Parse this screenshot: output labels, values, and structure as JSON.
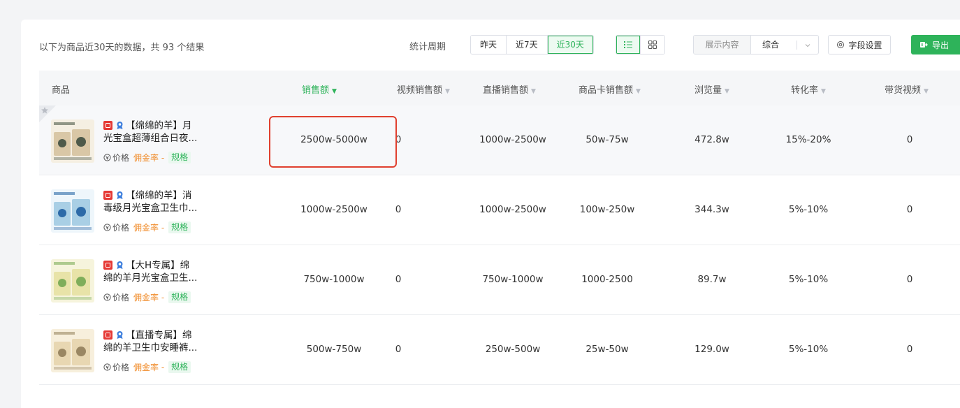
{
  "toolbar": {
    "summary": "以下为商品近30天的数据，共 93 个结果",
    "period_label": "统计周期",
    "periods": [
      "昨天",
      "近7天",
      "近30天"
    ],
    "active_period": "近30天",
    "display_label": "展示内容",
    "display_value": "综合",
    "field_settings": "字段设置",
    "export": "导出"
  },
  "table": {
    "columns": [
      "商品",
      "销售额",
      "视频销售额",
      "直播销售额",
      "商品卡销售额",
      "浏览量",
      "转化率",
      "带货视频"
    ],
    "sorted_column": "销售额",
    "meta": {
      "price": "价格",
      "commission": "佣金率 -",
      "spec": "规格"
    },
    "rows": [
      {
        "name_line1": "【绵绵的羊】月",
        "name_line2": "光宝盒超薄组合日夜...",
        "sales": "2500w-5000w",
        "video_sales": "0",
        "live_sales": "1000w-2500w",
        "card_sales": "50w-75w",
        "views": "472.8w",
        "conversion": "15%-20%",
        "videos": "0"
      },
      {
        "name_line1": "【绵绵的羊】消",
        "name_line2": "毒级月光宝盒卫生巾...",
        "sales": "1000w-2500w",
        "video_sales": "0",
        "live_sales": "1000w-2500w",
        "card_sales": "100w-250w",
        "views": "344.3w",
        "conversion": "5%-10%",
        "videos": "0"
      },
      {
        "name_line1": "【大H专属】绵",
        "name_line2": "绵的羊月光宝盒卫生...",
        "sales": "750w-1000w",
        "video_sales": "0",
        "live_sales": "750w-1000w",
        "card_sales": "1000-2500",
        "views": "89.7w",
        "conversion": "5%-10%",
        "videos": "0"
      },
      {
        "name_line1": "【直播专属】绵",
        "name_line2": "绵的羊卫生巾安睡裤...",
        "sales": "500w-750w",
        "video_sales": "0",
        "live_sales": "250w-500w",
        "card_sales": "25w-50w",
        "views": "129.0w",
        "conversion": "5%-10%",
        "videos": "0"
      }
    ]
  },
  "colors": {
    "accent": "#2eb35a",
    "orange": "#f08c2b",
    "highlight": "#e0402f",
    "brand_red": "#e53935"
  }
}
